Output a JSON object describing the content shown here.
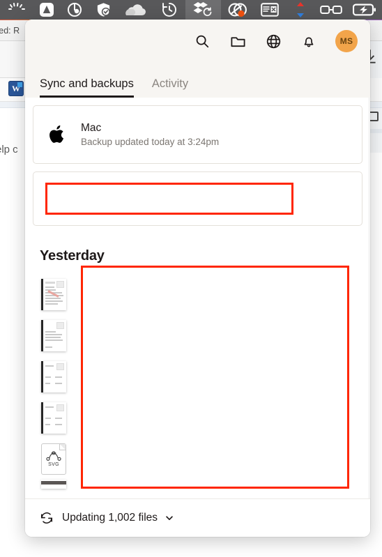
{
  "menubar": {
    "items": [
      {
        "name": "brightness-icon",
        "label": "Brightness"
      },
      {
        "name": "adobe-creative-cloud-icon",
        "label": "Adobe Creative Cloud"
      },
      {
        "name": "screen-sharing-icon",
        "label": "Screen Sharing"
      },
      {
        "name": "security-shield-icon",
        "label": "Security"
      },
      {
        "name": "onedrive-cloud-icon",
        "label": "OneDrive"
      },
      {
        "name": "time-machine-icon",
        "label": "Time Machine"
      },
      {
        "name": "dropbox-sync-icon",
        "label": "Dropbox"
      },
      {
        "name": "carbon-copy-cloner-icon",
        "label": "Carbon Copy Cloner"
      },
      {
        "name": "window-manager-icon",
        "label": "Window Manager"
      },
      {
        "name": "network-activity-icon",
        "label": "Network Activity"
      },
      {
        "name": "night-shift-glasses-icon",
        "label": "Night Shift"
      },
      {
        "name": "battery-charging-icon",
        "label": "Battery"
      }
    ]
  },
  "background": {
    "title_text": "ved: R",
    "body_text": "elp c",
    "word_icon_letter": "W",
    "download_icon_name": "download-icon"
  },
  "popup": {
    "header": {
      "icons": [
        {
          "name": "search-icon",
          "label": "Search"
        },
        {
          "name": "folder-icon",
          "label": "Files"
        },
        {
          "name": "globe-icon",
          "label": "Web"
        },
        {
          "name": "bell-icon",
          "label": "Notifications"
        }
      ],
      "avatar": {
        "initials": "MS",
        "color": "#f2a44a"
      }
    },
    "tabs": [
      {
        "label": "Sync and backups",
        "active": true
      },
      {
        "label": "Activity",
        "active": false
      }
    ],
    "device_card": {
      "icon": "apple-logo-icon",
      "name": "Mac",
      "status": "Backup updated today at 3:24pm"
    },
    "redacted_card": {
      "highlight_color": "#ff2600",
      "content": ""
    },
    "section": {
      "title": "Yesterday"
    },
    "files": [
      {
        "thumb": "document-thumbnail",
        "name": ""
      },
      {
        "thumb": "document-thumbnail",
        "name": ""
      },
      {
        "thumb": "document-thumbnail",
        "name": ""
      },
      {
        "thumb": "document-thumbnail",
        "name": ""
      },
      {
        "thumb": "svg-file-thumbnail",
        "name": "",
        "label": "SVG"
      },
      {
        "thumb": "document-thumbnail-partial",
        "name": ""
      }
    ],
    "redaction_overlay": {
      "highlight_color": "#ff2600"
    },
    "footer": {
      "icon": "sync-refresh-icon",
      "status_text": "Updating 1,002 files",
      "chevron": "chevron-down-icon"
    }
  }
}
